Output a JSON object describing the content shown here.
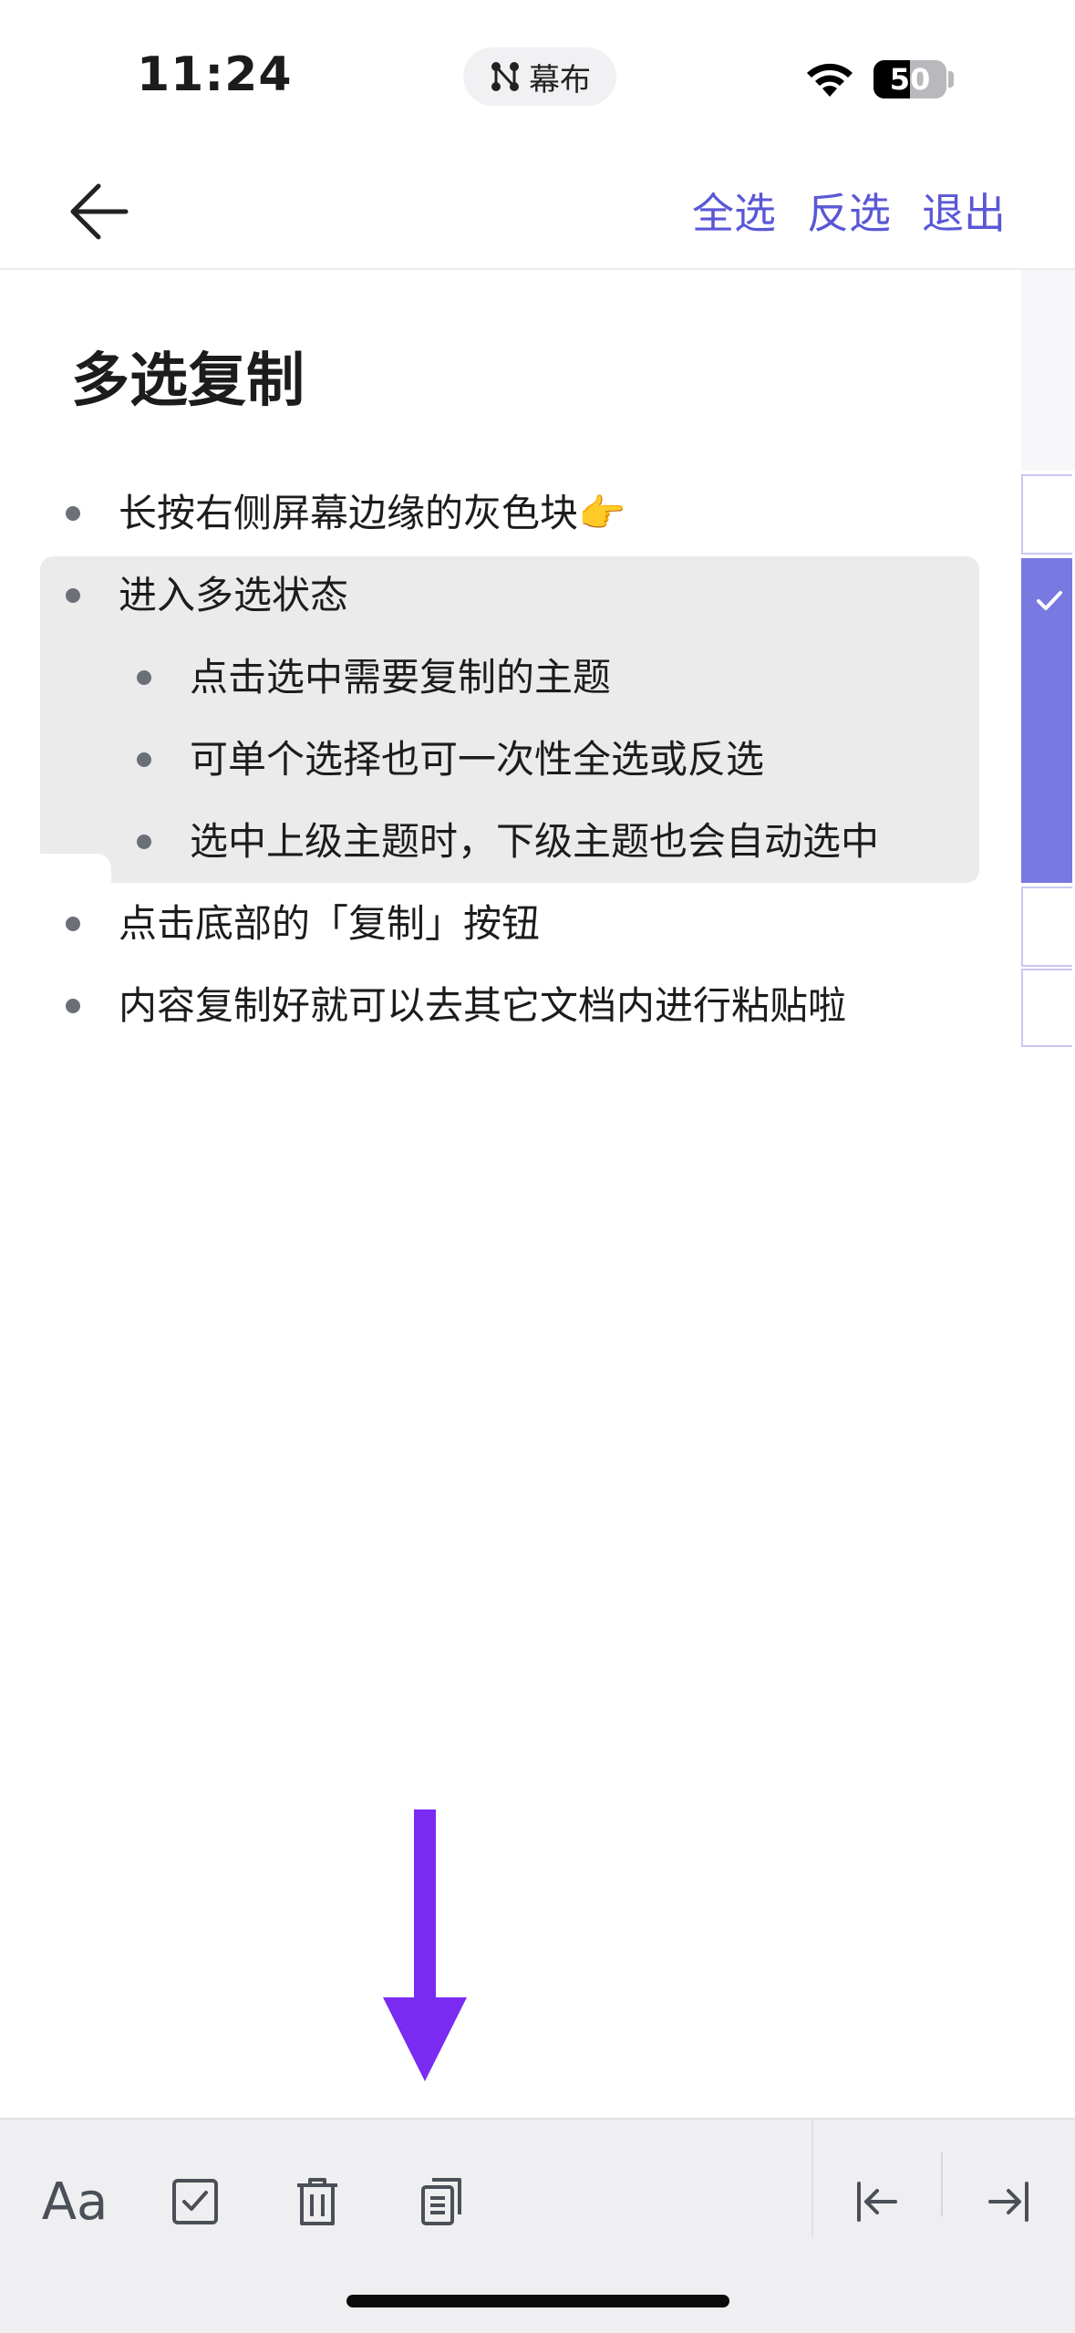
{
  "status": {
    "time": "11:24",
    "island_app": "幕布",
    "battery_level": "50"
  },
  "nav": {
    "select_all": "全选",
    "invert_select": "反选",
    "exit": "退出"
  },
  "doc": {
    "title": "多选复制",
    "items": [
      {
        "text": "长按右侧屏幕边缘的灰色块👉",
        "level": 0,
        "selected": false
      },
      {
        "text": "进入多选状态",
        "level": 0,
        "selected": true
      },
      {
        "text": "点击选中需要复制的主题",
        "level": 1,
        "selected": true
      },
      {
        "text": "可单个选择也可一次性全选或反选",
        "level": 1,
        "selected": true
      },
      {
        "text": "选中上级主题时，下级主题也会自动选中",
        "level": 1,
        "selected": true
      },
      {
        "text": "点击底部的「复制」按钮",
        "level": 0,
        "selected": false
      },
      {
        "text": "内容复制好就可以去其它文档内进行粘贴啦",
        "level": 0,
        "selected": false
      }
    ]
  },
  "toolbar": {
    "font_label": "Aa"
  },
  "colors": {
    "accent": "#5a57d6",
    "selection_column": "#7879e1",
    "annotation_arrow": "#7a2bf2"
  }
}
